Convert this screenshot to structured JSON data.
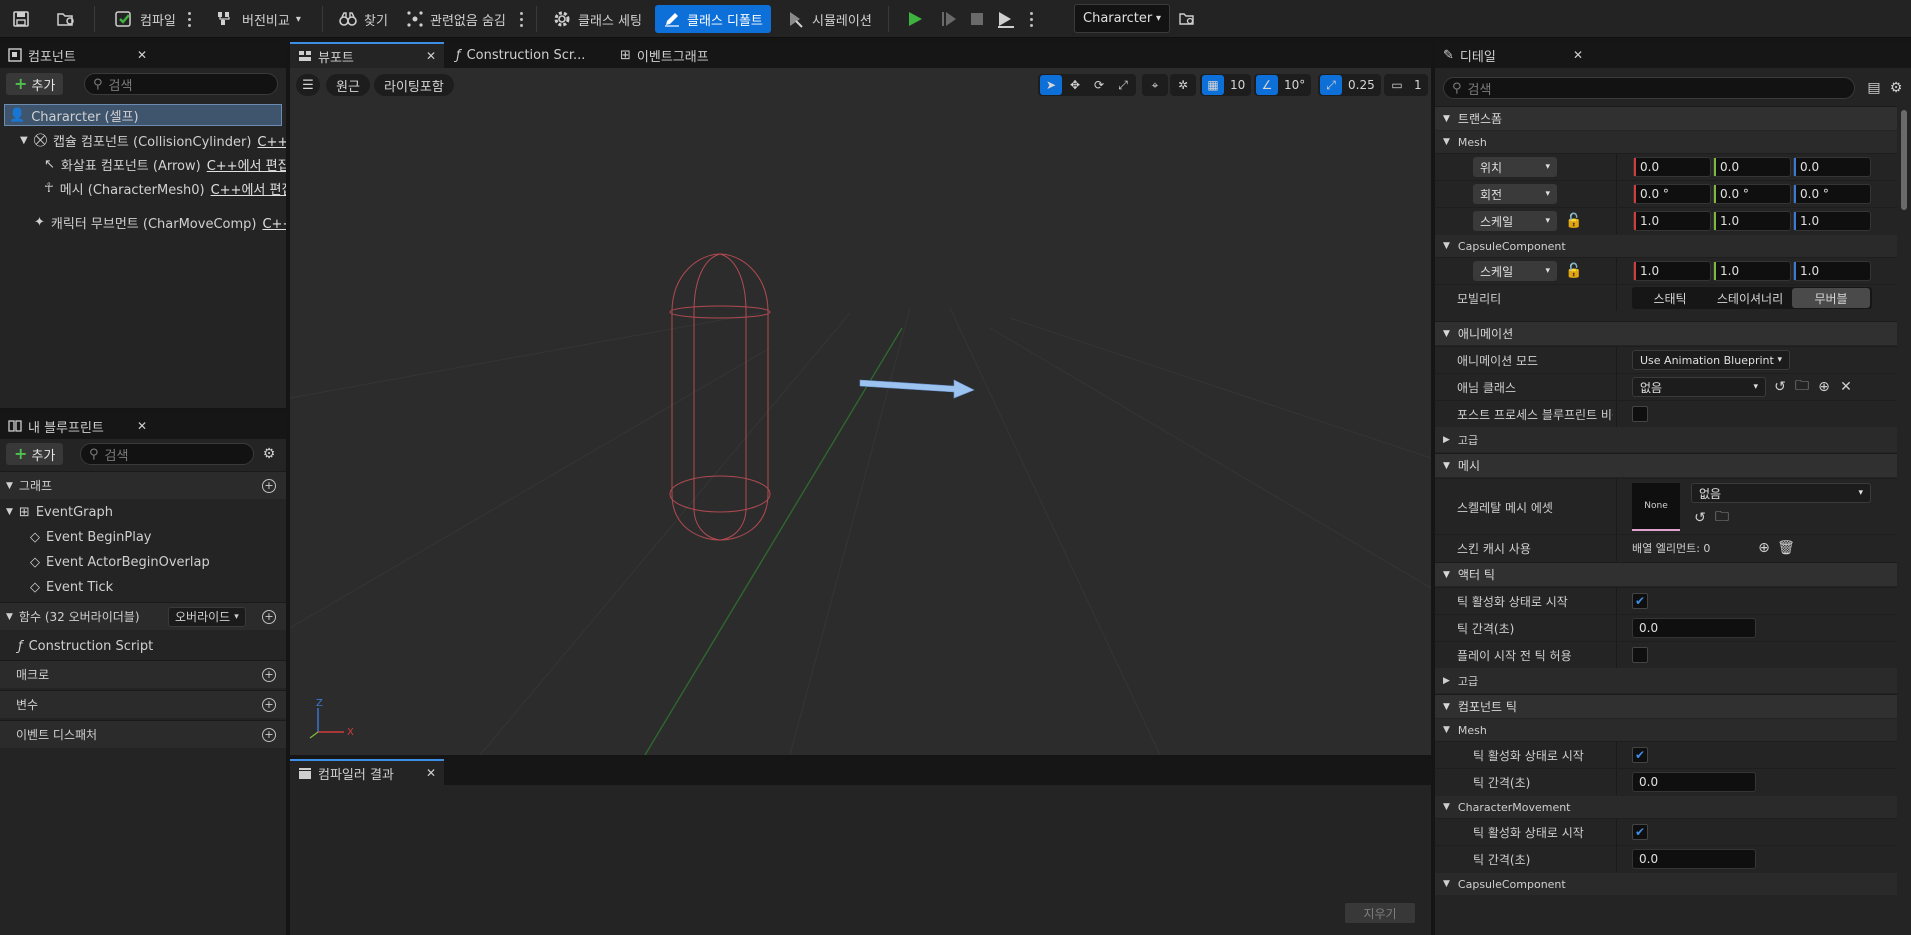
{
  "toolbar": {
    "compile": "컴파일",
    "diff": "버전비교",
    "find": "찾기",
    "hide_unrelated": "관련없음 숨김",
    "class_settings": "클래스 세팅",
    "class_defaults": "클래스 디폴트",
    "simulation": "시뮬레이션",
    "blueprint_name": "Chararcter"
  },
  "components": {
    "tab": "컴포넌트",
    "add": "추가",
    "search_placeholder": "검색",
    "items": [
      {
        "label": "Chararcter (셀프)",
        "edit": ""
      },
      {
        "label": "캡슐 컴포넌트 (CollisionCylinder)",
        "edit": "C++에..."
      },
      {
        "label": "화살표 컴포넌트 (Arrow)",
        "edit": "C++에서 편집"
      },
      {
        "label": "메시 (CharacterMesh0)",
        "edit": "C++에서 편집"
      },
      {
        "label": "캐릭터 무브먼트 (CharMoveComp)",
        "edit": "C++에..."
      }
    ]
  },
  "my_blueprint": {
    "tab": "내 블루프린트",
    "add": "추가",
    "search_placeholder": "검색",
    "graphs": "그래프",
    "event_graph": "EventGraph",
    "events": [
      "Event BeginPlay",
      "Event ActorBeginOverlap",
      "Event Tick"
    ],
    "functions": "함수 (32 오버라이더블)",
    "override": "오버라이드",
    "construction_script": "Construction Script",
    "macros": "매크로",
    "variables": "변수",
    "dispatchers": "이벤트 디스패처"
  },
  "viewport": {
    "tabs": [
      "뷰포트",
      "Construction Scr...",
      "이벤트그래프"
    ],
    "perspective": "원근",
    "lit": "라이팅포함",
    "grid_size": "10",
    "rot_snap": "10°",
    "scale_snap": "0.25",
    "camera_speed": "1"
  },
  "compiler": {
    "tab": "컴파일러 결과",
    "clear": "지우기"
  },
  "details": {
    "tab": "디테일",
    "search_placeholder": "검색",
    "transform": "트랜스폼",
    "mesh_sub": "Mesh",
    "location": "위치",
    "rotation": "회전",
    "scale": "스케일",
    "loc_values": [
      "0.0",
      "0.0",
      "0.0"
    ],
    "rot_values": [
      "0.0 °",
      "0.0 °",
      "0.0 °"
    ],
    "scale_values": [
      "1.0",
      "1.0",
      "1.0"
    ],
    "capsule_sub": "CapsuleComponent",
    "capsule_scale_values": [
      "1.0",
      "1.0",
      "1.0"
    ],
    "mobility": "모빌리티",
    "mobility_options": [
      "스태틱",
      "스테이셔너리",
      "무버블"
    ],
    "animation": "애니메이션",
    "anim_mode": "애니메이션 모드",
    "anim_mode_value": "Use Animation Blueprint",
    "anim_class": "애님 클래스",
    "anim_class_value": "없음",
    "post_process": "포스트 프로세스 블루프린트 비활...",
    "advanced": "고급",
    "mesh": "메시",
    "skeletal_mesh": "스켈레탈 메시 에셋",
    "skeletal_none_thumb": "None",
    "skeletal_value": "없음",
    "skin_cache": "스킨 캐시 사용",
    "skin_cache_value": "배열 엘리먼트: 0",
    "actor_tick": "액터 틱",
    "tick_start": "틱 활성화 상태로 시작",
    "tick_interval": "틱 간격(초)",
    "tick_interval_value": "0.0",
    "tick_before_play": "플레이 시작 전 틱 허용",
    "advanced2": "고급",
    "component_tick": "컴포넌트 틱",
    "ct_mesh": "Mesh",
    "ct_mesh_tick_start": "틱 활성화 상태로 시작",
    "ct_mesh_interval": "틱 간격(초)",
    "ct_mesh_interval_value": "0.0",
    "ct_charmove": "CharacterMovement",
    "ct_cm_tick_start": "틱 활성화 상태로 시작",
    "ct_cm_interval": "틱 간격(초)",
    "ct_cm_interval_value": "0.0",
    "ct_capsule": "CapsuleComponent"
  },
  "colors": {
    "accent": "#0d6fd8",
    "x_axis": "#d23c3c",
    "y_axis": "#7fb73b",
    "z_axis": "#3b79d6",
    "play_green": "#3fb33f"
  }
}
